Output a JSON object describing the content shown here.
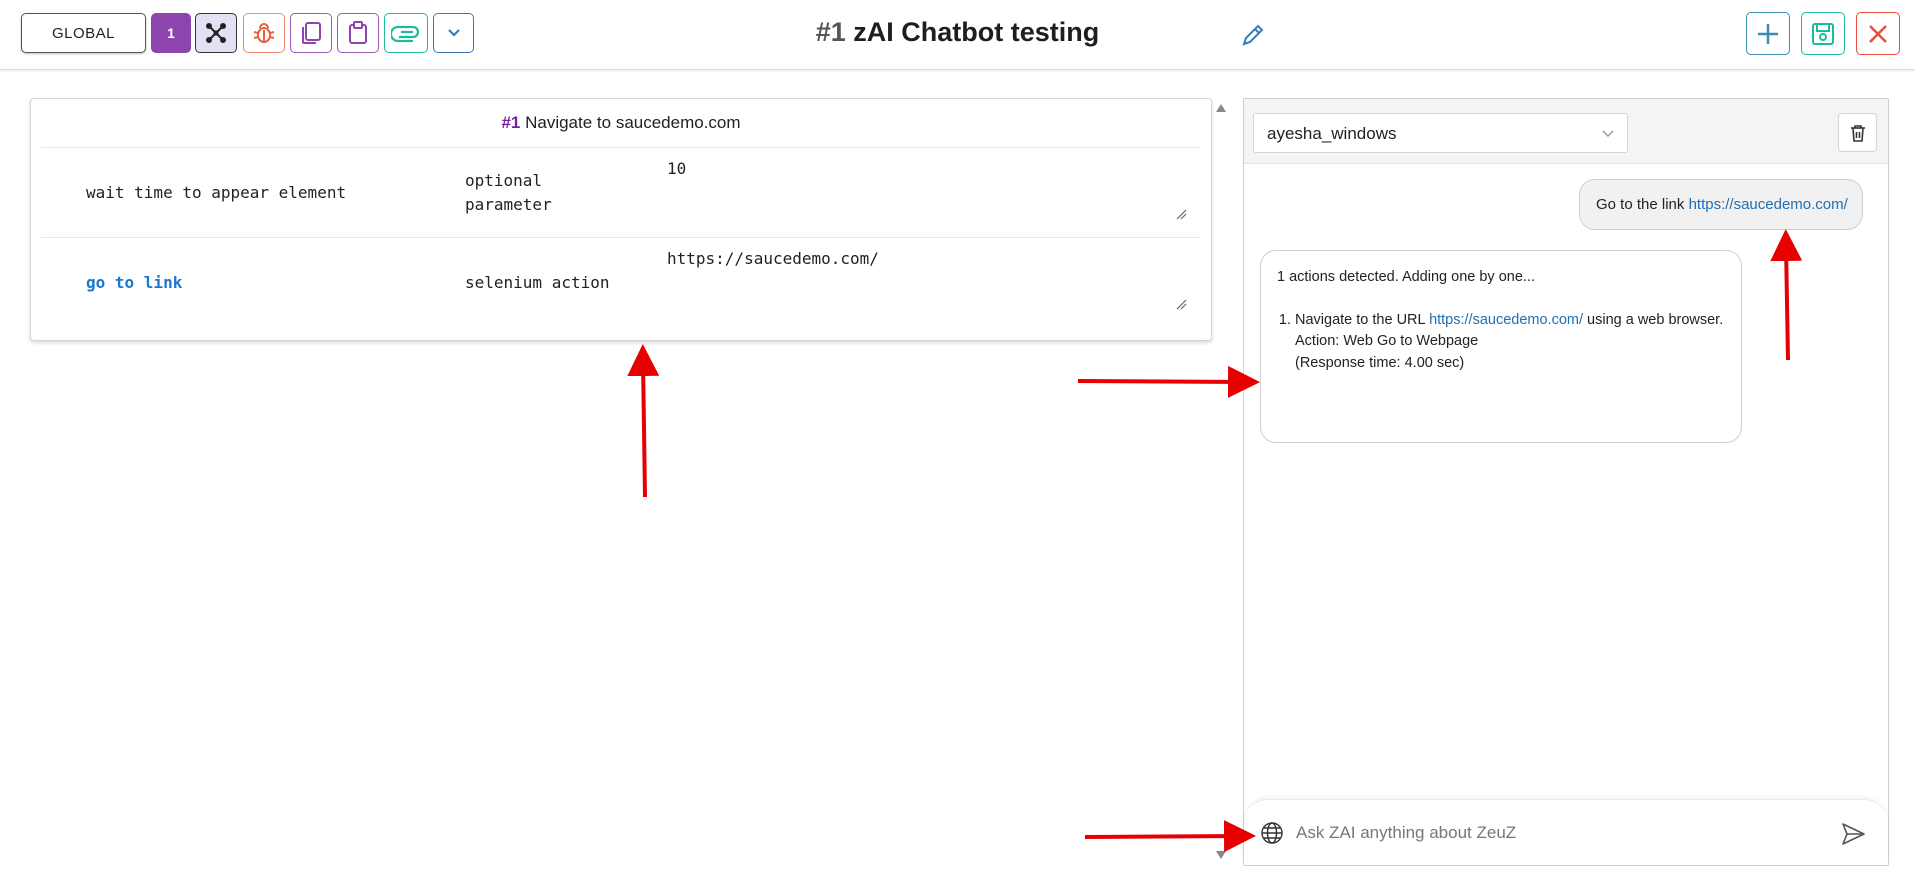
{
  "toolbar": {
    "global_label": "GLOBAL",
    "step_count_label": "1",
    "icons": [
      "graph-icon",
      "bug-icon",
      "copy-icon",
      "clipboard-icon",
      "paperclip-icon",
      "chevron-down-icon"
    ],
    "colors": {
      "purple": "#8e44ad",
      "teal": "#1abc9c",
      "red": "#e74c3c",
      "blue": "#3d8bb5"
    }
  },
  "header": {
    "hash": "#1",
    "title": "zAI Chatbot testing",
    "right_icons": [
      "plus-icon",
      "save-icon",
      "close-icon"
    ]
  },
  "step": {
    "number": "#1",
    "title": "Navigate to saucedemo.com",
    "rows": [
      {
        "action": "wait time to appear element",
        "type": "optional\nparameter",
        "value": "10"
      },
      {
        "action": "go to link",
        "type": "selenium action",
        "value": "https://saucedemo.com/"
      }
    ]
  },
  "chat": {
    "selected_model": "ayesha_windows",
    "user_message": {
      "prefix": "Go to the link ",
      "link": "https://saucedemo.com/"
    },
    "bot_message": {
      "intro": "1 actions detected. Adding one by one...",
      "item_prefix": "Navigate to the URL ",
      "item_link": "https://saucedemo.com/",
      "item_suffix": " using a web browser.",
      "action_line": "Action: Web Go to Webpage",
      "response_line": "(Response time: 4.00 sec)"
    },
    "input_placeholder": "Ask ZAI anything about ZeuZ"
  }
}
